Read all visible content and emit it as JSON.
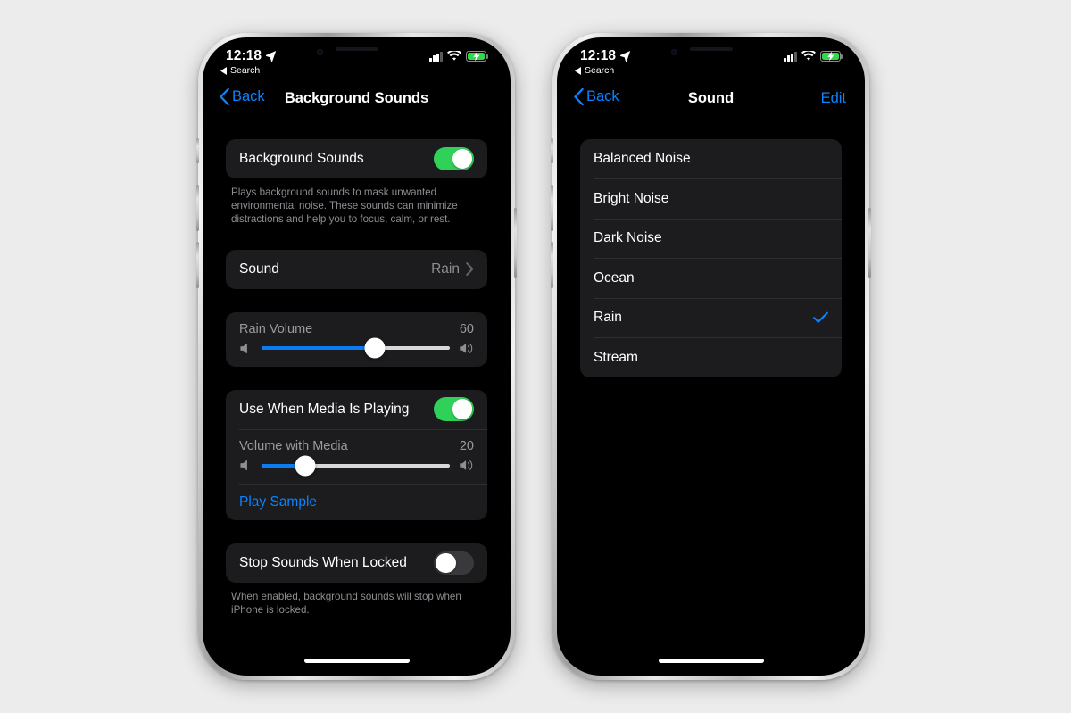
{
  "page": {
    "background_color": "#ececec"
  },
  "phones": [
    {
      "id": "phone-left",
      "status_bar": {
        "time": "12:18",
        "location_icon": "location-arrow-icon",
        "back_chevron": "triangle-left-icon",
        "back_app": "Search",
        "cellular_icon": "cellular-bars-icon",
        "cellular_bars_filled": 3,
        "cellular_bars_total": 4,
        "wifi_icon": "wifi-icon",
        "battery_icon": "battery-charging-icon",
        "battery_color": "#32d74b",
        "battery_bolt_icon": "lightning-bolt-icon"
      },
      "nav": {
        "back_icon": "chevron-left-icon",
        "back_label": "Back",
        "title": "Background Sounds",
        "action_label": ""
      },
      "sections": [
        {
          "type": "toggle-card",
          "rows": [
            {
              "label": "Background Sounds",
              "toggle": "on"
            }
          ],
          "footnote": "Plays background sounds to mask unwanted environmental noise. These sounds can minimize distractions and help you to focus, calm, or rest."
        },
        {
          "type": "value-card",
          "rows": [
            {
              "label": "Sound",
              "value": "Rain",
              "disclosure_icon": "chevron-right-icon"
            }
          ]
        },
        {
          "type": "slider-card",
          "slider": {
            "label": "Rain Volume",
            "value": "60",
            "percent": 60,
            "min_icon": "speaker-low-icon",
            "max_icon": "speaker-high-icon",
            "fill_color": "#0a7cf0"
          }
        },
        {
          "type": "media-card",
          "toggle_row": {
            "label": "Use When Media Is Playing",
            "toggle": "on"
          },
          "slider": {
            "label": "Volume with Media",
            "value": "20",
            "percent": 23,
            "min_icon": "speaker-low-icon",
            "max_icon": "speaker-high-icon",
            "fill_color": "#0a7cf0"
          },
          "link": {
            "label": "Play Sample"
          }
        },
        {
          "type": "toggle-card",
          "rows": [
            {
              "label": "Stop Sounds When Locked",
              "toggle": "off"
            }
          ],
          "footnote": "When enabled, background sounds will stop when iPhone is locked."
        }
      ]
    },
    {
      "id": "phone-right",
      "status_bar": {
        "time": "12:18",
        "location_icon": "location-arrow-icon",
        "back_chevron": "triangle-left-icon",
        "back_app": "Search",
        "cellular_icon": "cellular-bars-icon",
        "cellular_bars_filled": 3,
        "cellular_bars_total": 4,
        "wifi_icon": "wifi-icon",
        "battery_icon": "battery-charging-icon",
        "battery_color": "#32d74b",
        "battery_bolt_icon": "lightning-bolt-icon"
      },
      "nav": {
        "back_icon": "chevron-left-icon",
        "back_label": "Back",
        "title": "Sound",
        "action_label": "Edit"
      },
      "sound_list": {
        "items": [
          {
            "label": "Balanced Noise",
            "selected": false
          },
          {
            "label": "Bright Noise",
            "selected": false
          },
          {
            "label": "Dark Noise",
            "selected": false
          },
          {
            "label": "Ocean",
            "selected": false
          },
          {
            "label": "Rain",
            "selected": true
          },
          {
            "label": "Stream",
            "selected": false
          }
        ],
        "check_icon": "checkmark-icon",
        "check_color": "#0a84ff"
      }
    }
  ]
}
